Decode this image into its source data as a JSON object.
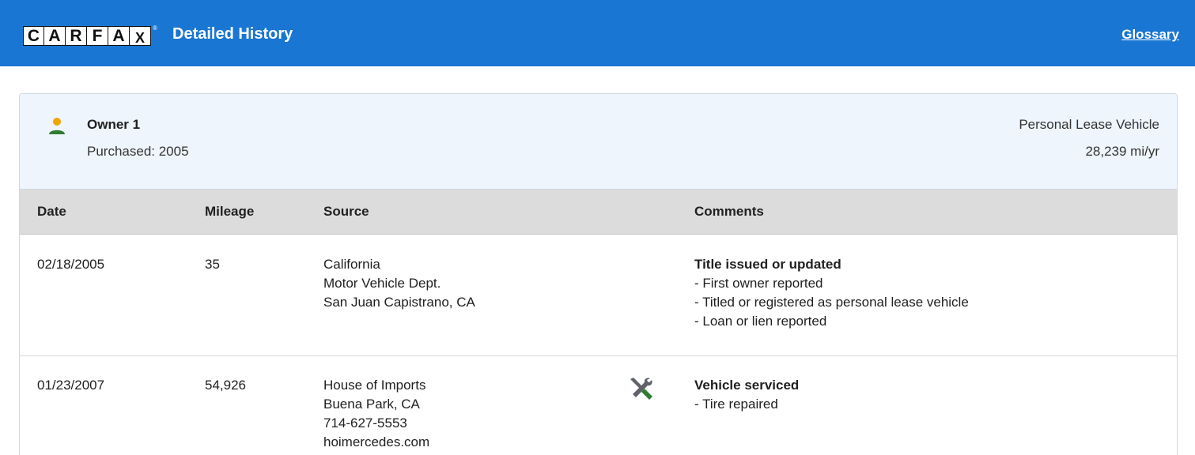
{
  "header": {
    "logo_letters": [
      "C",
      "A",
      "R",
      "F",
      "A",
      "X"
    ],
    "logo_reg": "®",
    "title": "Detailed History",
    "glossary_label": "Glossary",
    "bar_color": "#1976d2"
  },
  "owner": {
    "icon": "person-icon",
    "name": "Owner 1",
    "purchased": "Purchased: 2005",
    "vehicle_type": "Personal Lease Vehicle",
    "annual_miles": "28,239 mi/yr"
  },
  "table": {
    "columns": [
      "Date",
      "Mileage",
      "Source",
      "Comments"
    ],
    "rows": [
      {
        "date": "02/18/2005",
        "mileage": "35",
        "source": [
          "California",
          "Motor Vehicle Dept.",
          "San Juan Capistrano, CA"
        ],
        "comment_title": "Title issued or updated",
        "comment_items": [
          "- First owner reported",
          "- Titled or registered as personal lease vehicle",
          "- Loan or lien reported"
        ]
      },
      {
        "date": "01/23/2007",
        "mileage": "54,926",
        "source": [
          "House of Imports",
          "Buena Park, CA",
          "714-627-5553",
          "hoimercedes.com"
        ],
        "icon": "service-tools-icon",
        "comment_title": "Vehicle serviced",
        "comment_items": [
          "- Tire repaired"
        ]
      }
    ]
  }
}
